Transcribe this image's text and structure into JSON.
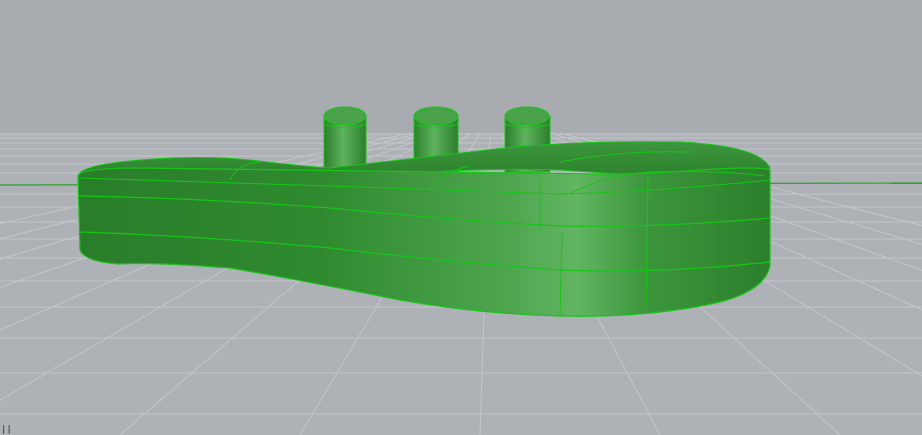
{
  "viewport": {
    "name": "Perspective",
    "background_color": "#a8abb0",
    "grid_color": "#bfc2c6",
    "grid_major_color": "#c7cacd",
    "x_axis_color": "#2aa12a",
    "object_color": "#2f8f2f",
    "edge_color": "#19c419",
    "object_name": "green-enclosure-with-three-pegs",
    "corner_glyph": "||"
  }
}
